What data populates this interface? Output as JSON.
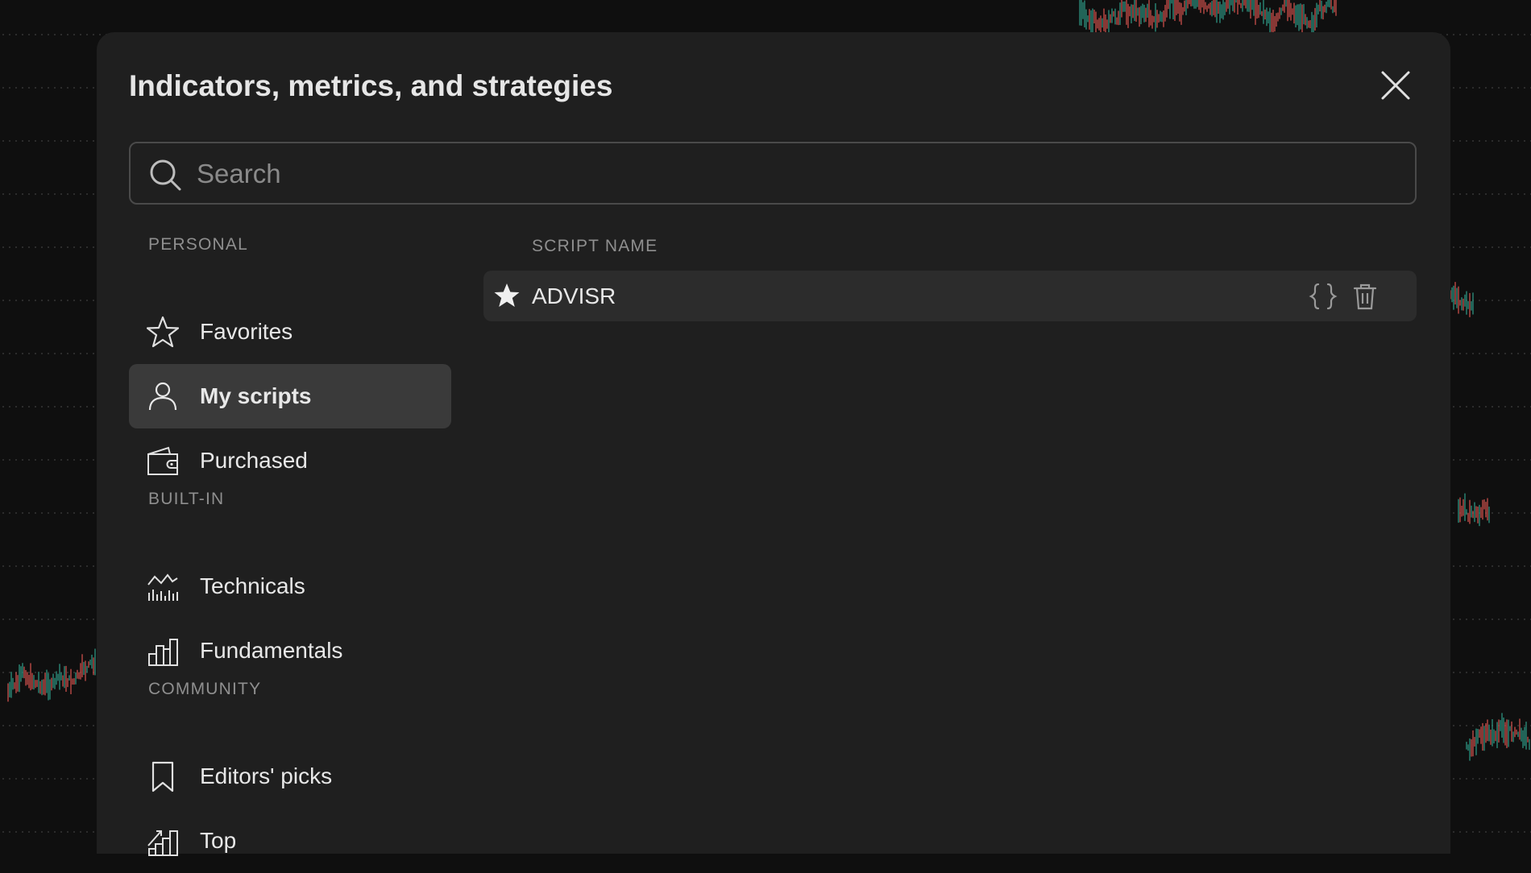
{
  "dialog": {
    "title": "Indicators, metrics, and strategies"
  },
  "search": {
    "placeholder": "Search",
    "value": ""
  },
  "sidebar": {
    "sections": [
      {
        "label": "PERSONAL",
        "items": [
          {
            "label": "Favorites",
            "icon": "star-outline-icon",
            "active": false
          },
          {
            "label": "My scripts",
            "icon": "user-icon",
            "active": true
          },
          {
            "label": "Purchased",
            "icon": "wallet-icon",
            "active": false
          }
        ]
      },
      {
        "label": "BUILT-IN",
        "items": [
          {
            "label": "Technicals",
            "icon": "technicals-chart-icon",
            "active": false
          },
          {
            "label": "Fundamentals",
            "icon": "bar-chart-icon",
            "active": false
          }
        ]
      },
      {
        "label": "COMMUNITY",
        "items": [
          {
            "label": "Editors' picks",
            "icon": "bookmark-icon",
            "active": false
          },
          {
            "label": "Top",
            "icon": "trending-bars-icon",
            "active": false
          }
        ]
      }
    ]
  },
  "scripts": {
    "column_header": "SCRIPT NAME",
    "rows": [
      {
        "name": "ADVISR",
        "favorite": true,
        "actions": [
          "source-code-icon",
          "trash-icon"
        ]
      }
    ]
  },
  "colors": {
    "dialog_bg": "#1f1f1f",
    "active_item_bg": "#3a3a3a",
    "row_bg": "#2c2c2c",
    "text": "#e8e8e8",
    "muted": "#8f8f8f",
    "candle_up": "#2f9e88",
    "candle_down": "#d9534f"
  }
}
